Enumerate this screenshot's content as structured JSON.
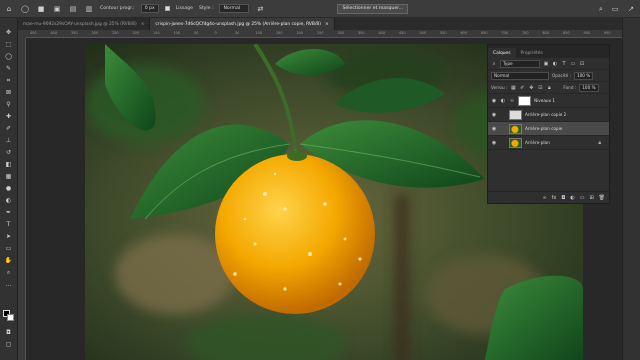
{
  "options_bar": {
    "contour_label": "Contour progr.:",
    "contour_value": "0 px",
    "lissage_label": "Lissage",
    "style_label": "Style :",
    "style_value": "Normal",
    "select_mask_button": "Sélectionner et masquer..."
  },
  "tabs": [
    {
      "label": "mae-mu-9692s29sOAY-unsplash.jpg @ 25% (RVB/8)",
      "close": "×",
      "active": false
    },
    {
      "label": "crispin-jones-7d6cQCfdg4o-unsplash.jpg @ 25% (Arrière-plan copie, RVB/8)",
      "close": "×",
      "active": true
    }
  ],
  "ruler_ticks": [
    "450",
    "400",
    "350",
    "300",
    "250",
    "200",
    "150",
    "100",
    "50",
    "0",
    "50",
    "100",
    "150",
    "200",
    "250",
    "300",
    "350",
    "400",
    "450",
    "500",
    "550",
    "600",
    "650",
    "700",
    "750",
    "800",
    "850",
    "900",
    "950"
  ],
  "layers_panel": {
    "tabs": [
      "Calques",
      "Propriétés"
    ],
    "filter_value": "Type",
    "blend_mode": "Normal",
    "opacity_label": "Opacité :",
    "opacity_value": "100 %",
    "lock_label": "Verrou :",
    "fill_label": "Fond :",
    "fill_value": "100 %",
    "layers": [
      {
        "name": "Niveaux 1",
        "selected": false,
        "locked": false,
        "kind": "adjustment"
      },
      {
        "name": "Arrière-plan copie 2",
        "selected": false,
        "locked": false,
        "kind": "photo"
      },
      {
        "name": "Arrière-plan copie",
        "selected": true,
        "locked": false,
        "kind": "photo"
      },
      {
        "name": "Arrière-plan",
        "selected": false,
        "locked": true,
        "kind": "photo"
      }
    ]
  },
  "colors": {
    "accent_orange": "#f5a300",
    "leaf_green": "#1f6b2c",
    "panel_bg": "#2f2f2f"
  }
}
